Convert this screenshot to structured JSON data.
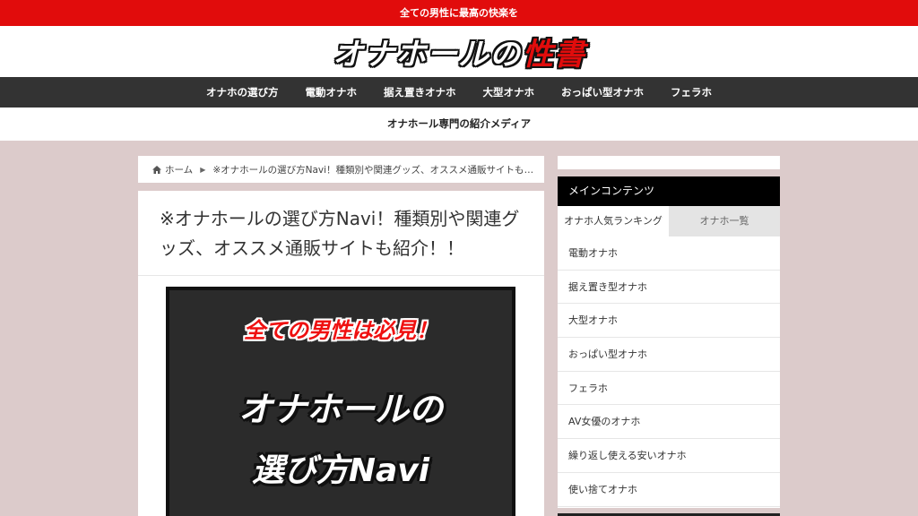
{
  "topbar": {
    "text": "全ての男性に最高の快楽を"
  },
  "header": {
    "logo_main": "オナホールの",
    "logo_accent": "性書"
  },
  "nav": {
    "items": [
      {
        "label": "オナホの選び方"
      },
      {
        "label": "電動オナホ"
      },
      {
        "label": "据え置きオナホ"
      },
      {
        "label": "大型オナホ"
      },
      {
        "label": "おっぱい型オナホ"
      },
      {
        "label": "フェラホ"
      }
    ]
  },
  "tagline": {
    "text": "オナホール専門の紹介メディア"
  },
  "breadcrumb": {
    "home_label": "ホーム",
    "current": "※オナホールの選び方Navi！種類別や関連グッズ、オススメ通販サイトも紹介！！"
  },
  "article": {
    "title": "※オナホールの選び方Navi！種類別や関連グッズ、オススメ通販サイトも紹介！！",
    "eyecatch": {
      "subtitle": "全ての男性は必見！",
      "line1": "オナホールの",
      "line2": "選び方Navi"
    }
  },
  "sidebar": {
    "widget_title": "メインコンテンツ",
    "tabs": [
      {
        "label": "オナホ人気ランキング"
      },
      {
        "label": "オナホ一覧"
      }
    ],
    "items": [
      {
        "label": "電動オナホ"
      },
      {
        "label": "据え置き型オナホ"
      },
      {
        "label": "大型オナホ"
      },
      {
        "label": "おっぱい型オナホ"
      },
      {
        "label": "フェラホ"
      },
      {
        "label": "AV女優のオナホ"
      },
      {
        "label": "繰り返し使える安いオナホ"
      },
      {
        "label": "使い捨てオナホ"
      }
    ]
  },
  "colors": {
    "brand_red": "#e10c0c",
    "nav_bg": "#333333",
    "page_bg": "#dccbcb"
  }
}
